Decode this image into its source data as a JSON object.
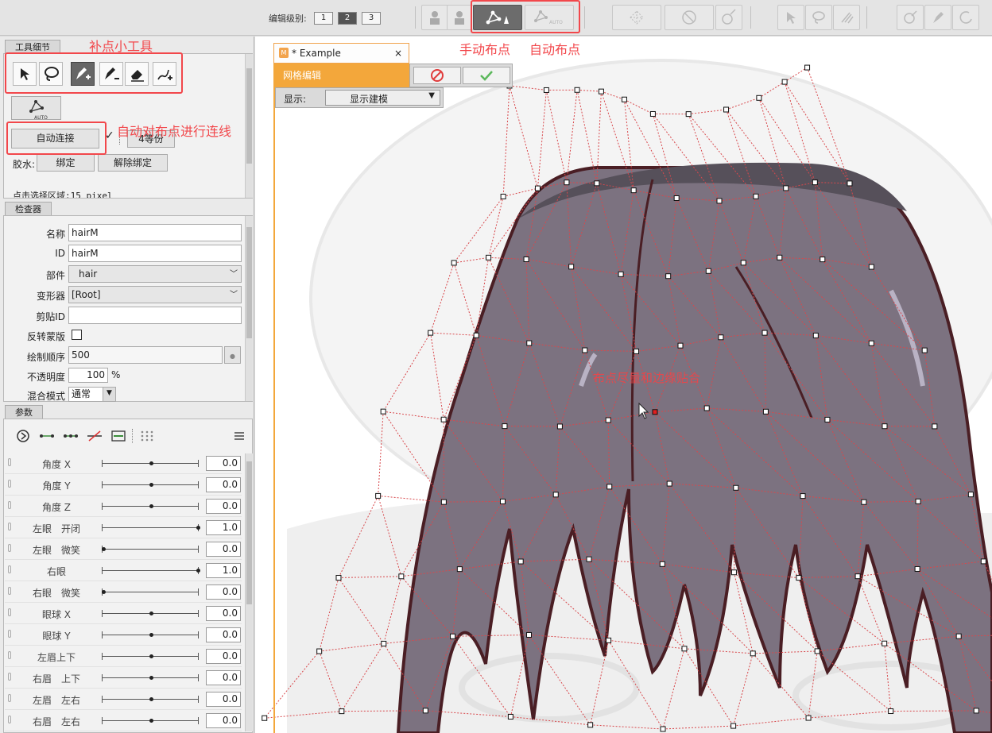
{
  "toolbar": {
    "edit_level_label": "编辑级别:",
    "levels": [
      "1",
      "2",
      "3"
    ],
    "auto_badge": "AUTO"
  },
  "tool_detail": {
    "tab_label": "工具细节",
    "auto_connect_label": "自动连接",
    "divide_label": "4等份",
    "glue_label": "胶水:",
    "bind_label": "绑定",
    "unbind_label": "解除绑定",
    "select_area_label": "点击选择区域:15 pixel"
  },
  "inspector": {
    "tab_label": "检查器",
    "name_label": "名称",
    "name_value": "hairM",
    "id_label": "ID",
    "id_value": "hairM",
    "part_label": "部件",
    "part_value": "hair",
    "deformer_label": "变形器",
    "deformer_value": "[Root]",
    "clip_label": "剪贴ID",
    "clip_value": "",
    "invert_mask_label": "反转蒙版",
    "draw_order_label": "绘制顺序",
    "draw_order_value": "500",
    "opacity_label": "不透明度",
    "opacity_value": "100",
    "opacity_unit": "%",
    "blend_label": "混合模式",
    "blend_value": "通常"
  },
  "params": {
    "tab_label": "参数",
    "rows": [
      {
        "name": "角度 X",
        "value": "0.0",
        "level": 0.5
      },
      {
        "name": "角度 Y",
        "value": "0.0",
        "level": 0.5
      },
      {
        "name": "角度 Z",
        "value": "0.0",
        "level": 0.5
      },
      {
        "name": "左眼　开闭",
        "value": "1.0",
        "level": 1.0
      },
      {
        "name": "左眼　微笑",
        "value": "0.0",
        "level": 0.0
      },
      {
        "name": "右眼",
        "value": "1.0",
        "level": 1.0
      },
      {
        "name": "右眼　微笑",
        "value": "0.0",
        "level": 0.0
      },
      {
        "name": "眼球 X",
        "value": "0.0",
        "level": 0.5
      },
      {
        "name": "眼球 Y",
        "value": "0.0",
        "level": 0.5
      },
      {
        "name": "左眉上下",
        "value": "0.0",
        "level": 0.5
      },
      {
        "name": "右眉　上下",
        "value": "0.0",
        "level": 0.5
      },
      {
        "name": "左眉　左右",
        "value": "0.0",
        "level": 0.5
      },
      {
        "name": "右眉　左右",
        "value": "0.0",
        "level": 0.5
      }
    ]
  },
  "document": {
    "tab_title": "* Example",
    "close_glyph": "×",
    "mode_label": "网格编辑",
    "show_label": "显示:",
    "show_value": "显示建模"
  },
  "annotations": {
    "add_point_tools": "补点小工具",
    "auto_connect_note": "自动对布点进行连线",
    "manual_placement": "手动布点",
    "auto_placement": "自动布点",
    "edge_note": "布点尽量和边缘贴合"
  },
  "colors": {
    "accent_orange": "#f3a73b",
    "annotation_red": "#f2474b",
    "mesh_red": "#d8484c"
  }
}
